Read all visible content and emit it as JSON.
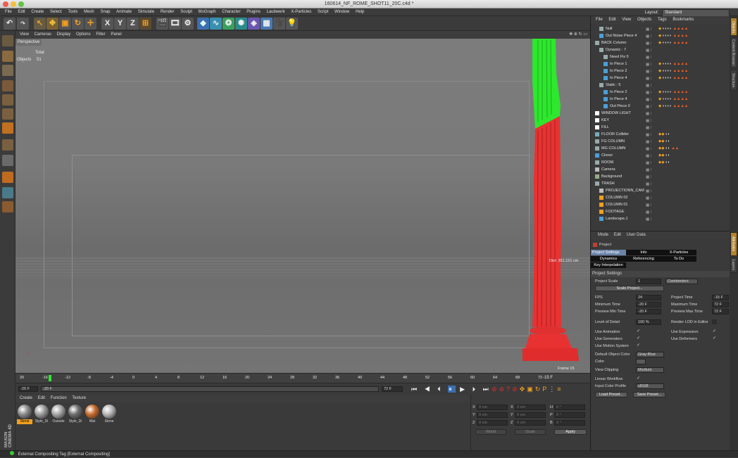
{
  "window": {
    "title": "160614_NF_ROME_SHOT11_20C.c4d *"
  },
  "menu": {
    "items": [
      "File",
      "Edit",
      "Create",
      "Select",
      "Tools",
      "Mesh",
      "Snap",
      "Animate",
      "Simulate",
      "Render",
      "Sculpt",
      "MoGraph",
      "Character",
      "Plugins",
      "Laubwerk",
      "X-Particles",
      "Script",
      "Window",
      "Help"
    ],
    "layout_label": "Layout:",
    "layout_value": "Standard"
  },
  "viewport": {
    "menu": [
      "View",
      "Cameras",
      "Display",
      "Options",
      "Filter",
      "Panel"
    ],
    "label": "Perspective",
    "stats_header": "Total",
    "stats_objects_label": "Objects",
    "stats_objects_value": "51",
    "dist_readout": "Dist: 351.121 cm",
    "frame_label": "Frame",
    "frame_value": "15"
  },
  "timeline": {
    "ticks": [
      "20",
      "-16",
      "-12",
      "-8",
      "-4",
      "0",
      "4",
      "8",
      "12",
      "16",
      "20",
      "24",
      "28",
      "32",
      "36",
      "40",
      "44",
      "48",
      "52",
      "56",
      "60",
      "64",
      "68",
      "72"
    ],
    "current_frame_marker": "-15",
    "end_readout": "-15 F",
    "start_field": "-20 F",
    "range_field_left": "-20 F",
    "range_field_right": "72 F",
    "end_field": "72 F"
  },
  "materials": {
    "menu": [
      "Create",
      "Edit",
      "Function",
      "Texture"
    ],
    "items": [
      {
        "label": "Stone",
        "color": "#8a8a8a",
        "selected": true
      },
      {
        "label": "Style_Di",
        "color": "#9b9b9b",
        "selected": false
      },
      {
        "label": "Outside",
        "color": "#a5a5a5",
        "selected": false
      },
      {
        "label": "Style_Di",
        "color": "#6e6e6e",
        "selected": false
      },
      {
        "label": "Mat",
        "color": "#c96a2a",
        "selected": false
      },
      {
        "label": "Stone",
        "color": "#b5b5b5",
        "selected": false
      }
    ]
  },
  "coords": {
    "rows": [
      {
        "a": "X",
        "av": "0 cm",
        "b": "X",
        "bv": "0 cm",
        "c": "H",
        "cv": "0 °"
      },
      {
        "a": "Y",
        "av": "0 cm",
        "b": "Y",
        "bv": "0 cm",
        "c": "P",
        "cv": "0 °"
      },
      {
        "a": "Z",
        "av": "0 cm",
        "b": "Z",
        "bv": "0 cm",
        "c": "B",
        "cv": "0 °"
      }
    ],
    "mode_left": "World",
    "mode_right": "Scale",
    "apply": "Apply"
  },
  "object_manager": {
    "menu": [
      "File",
      "Edit",
      "View",
      "Objects",
      "Tags",
      "Bookmarks"
    ],
    "objects": [
      {
        "name": "Null",
        "indent": 1,
        "icon": "null-icon"
      },
      {
        "name": "Out Noise Piece 4",
        "indent": 1,
        "icon": "fracture-icon"
      },
      {
        "name": "BACK Column",
        "indent": 0,
        "icon": "null-icon"
      },
      {
        "name": "Dynamic : 7",
        "indent": 1,
        "icon": "null-icon"
      },
      {
        "name": "Need Fix 0",
        "indent": 2,
        "icon": "null-icon"
      },
      {
        "name": "In Piece 1",
        "indent": 2,
        "icon": "fracture-icon"
      },
      {
        "name": "In Piece 2",
        "indent": 2,
        "icon": "fracture-icon"
      },
      {
        "name": "In Piece 4",
        "indent": 2,
        "icon": "fracture-icon"
      },
      {
        "name": "Static : 5",
        "indent": 1,
        "icon": "null-icon"
      },
      {
        "name": "In Piece 2",
        "indent": 2,
        "icon": "fracture-icon"
      },
      {
        "name": "In Piece 4",
        "indent": 2,
        "icon": "fracture-icon"
      },
      {
        "name": "Out Piece 0",
        "indent": 2,
        "icon": "fracture-icon"
      },
      {
        "name": "WINDOW LIGHT",
        "indent": 0,
        "icon": "light-icon"
      },
      {
        "name": "KEY",
        "indent": 0,
        "icon": "light-icon"
      },
      {
        "name": "FILL",
        "indent": 0,
        "icon": "light-icon"
      },
      {
        "name": "FLOOR Collider",
        "indent": 0,
        "icon": "plane-icon"
      },
      {
        "name": "FG COLUMN",
        "indent": 0,
        "icon": "null-icon"
      },
      {
        "name": "MG COLUMN",
        "indent": 0,
        "icon": "null-icon"
      },
      {
        "name": "Cloner",
        "indent": 0,
        "icon": "cloner-icon"
      },
      {
        "name": "ROOM",
        "indent": 0,
        "icon": "null-icon"
      },
      {
        "name": "Camera",
        "indent": 0,
        "icon": "camera-icon"
      },
      {
        "name": "Background",
        "indent": 0,
        "icon": "background-icon"
      },
      {
        "name": "TRASH",
        "indent": 0,
        "icon": "null-icon"
      },
      {
        "name": "PROJECTIONN_CAM",
        "indent": 1,
        "icon": "camera-icon"
      },
      {
        "name": "COLUMN 02",
        "indent": 1,
        "icon": "polygon-icon"
      },
      {
        "name": "COLUMN 01",
        "indent": 1,
        "icon": "polygon-icon"
      },
      {
        "name": "FOOTAGE",
        "indent": 1,
        "icon": "polygon-icon"
      },
      {
        "name": "Landscape.1",
        "indent": 1,
        "icon": "landscape-icon"
      }
    ]
  },
  "attributes": {
    "menu": [
      "Mode",
      "Edit",
      "User Data"
    ],
    "title": "Project",
    "tabs": [
      "Project Settings",
      "Info",
      "X-Particles",
      "Dynamics",
      "Referencing",
      "To Do",
      "Key Interpolation"
    ],
    "section": "Project Settings",
    "project_scale_label": "Project Scale",
    "project_scale_value": "1",
    "project_scale_unit": "Centimeters",
    "scale_project_btn": "Scale Project...",
    "fps_label": "FPS",
    "fps_value": "24",
    "project_time_label": "Project Time",
    "project_time_value": "-15 F",
    "min_time_label": "Minimum Time",
    "min_time_value": "-20 F",
    "max_time_label": "Maximum Time",
    "max_time_value": "72 F",
    "prev_min_label": "Preview Min Time",
    "prev_min_value": "-20 F",
    "prev_max_label": "Preview Max Time",
    "prev_max_value": "72 F",
    "lod_label": "Level of Detail",
    "lod_value": "100 %",
    "render_lod_label": "Render LOD in Editor",
    "use_anim_label": "Use Animation",
    "use_expr_label": "Use Expression",
    "use_gen_label": "Use Generators",
    "use_def_label": "Use Deformers",
    "use_motion_label": "Use Motion System",
    "default_color_label": "Default Object Color",
    "default_color_value": "Gray-Blue",
    "color_label": "Color",
    "view_clip_label": "View Clipping",
    "view_clip_value": "Medium",
    "linear_wf_label": "Linear Workflow",
    "input_profile_label": "Input Color Profile",
    "input_profile_value": "sRGB",
    "load_preset": "Load Preset...",
    "save_preset": "Save Preset..."
  },
  "side_tabs": [
    "Objects",
    "Content Browser",
    "Structure",
    "Attributes",
    "Layers"
  ],
  "status": {
    "text": "External Compositing Tag [External Compositing]"
  },
  "colors": {
    "green": "#2de82d",
    "red": "#e83232",
    "accent": "#f0a020",
    "selected": "#4a5c74"
  }
}
